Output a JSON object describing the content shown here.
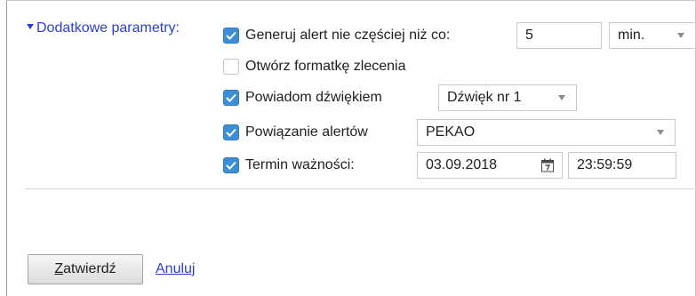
{
  "section": {
    "toggle_label": "Dodatkowe parametry:"
  },
  "params": {
    "alert": {
      "label": "Generuj alert nie częściej niż co:",
      "checked": true,
      "value": "5",
      "unit": "min."
    },
    "open_form": {
      "label": "Otwórz formatkę zlecenia",
      "checked": false
    },
    "sound": {
      "label": "Powiadom dźwiękiem",
      "checked": true,
      "value": "Dźwięk nr 1"
    },
    "link": {
      "label": "Powiązanie alertów",
      "checked": true,
      "value": "PEKAO"
    },
    "expiry": {
      "label": "Termin ważności:",
      "checked": true,
      "date": "03.09.2018",
      "time": "23:59:59"
    }
  },
  "actions": {
    "confirm_first": "Z",
    "confirm_rest": "atwierdź",
    "cancel_first": "A",
    "cancel_rest": "nuluj"
  }
}
